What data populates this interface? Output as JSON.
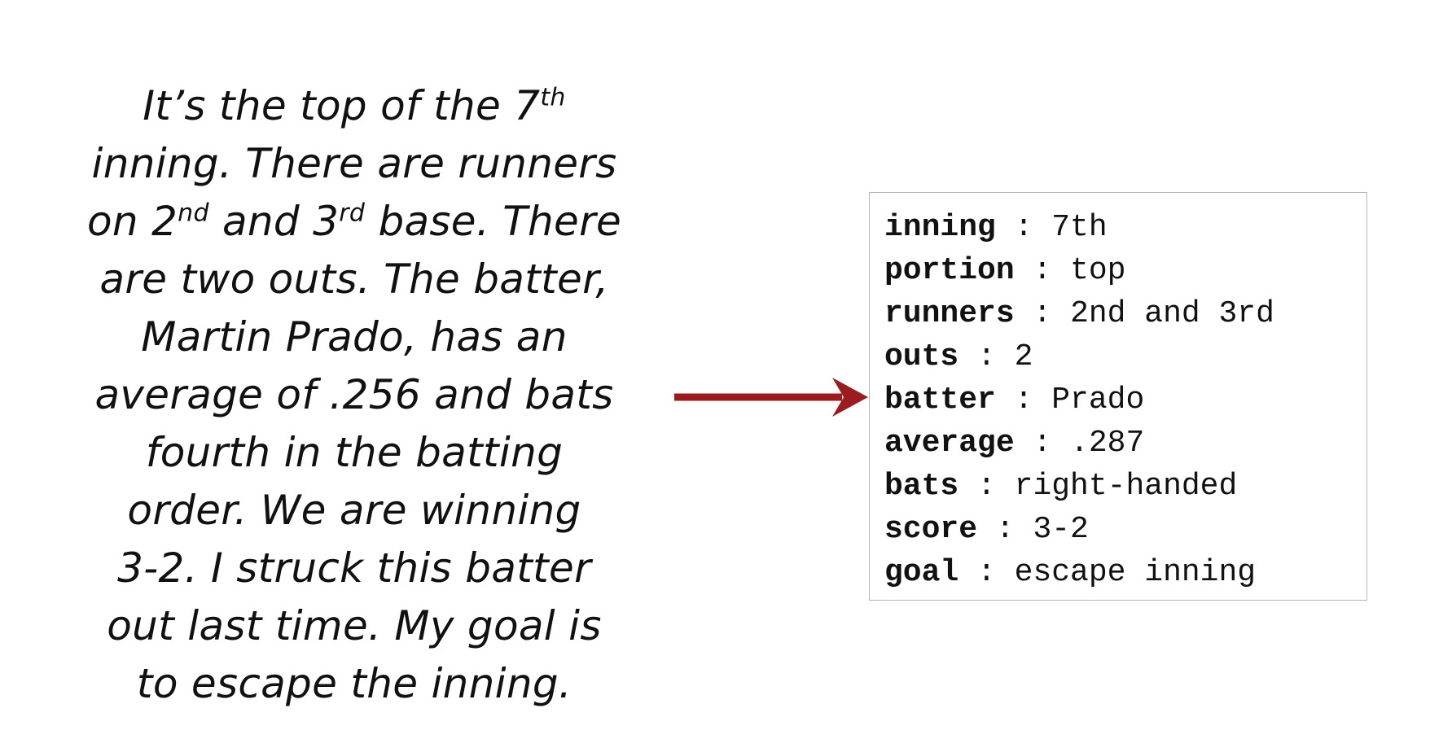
{
  "narrative": {
    "lines": [
      {
        "parts": [
          {
            "text": "It’s the top of the 7"
          },
          {
            "sup": "th"
          }
        ]
      },
      {
        "parts": [
          {
            "text": "inning. There are runners"
          }
        ]
      },
      {
        "parts": [
          {
            "text": "on 2"
          },
          {
            "sup": "nd"
          },
          {
            "text": " and 3"
          },
          {
            "sup": "rd"
          },
          {
            "text": " base. There"
          }
        ]
      },
      {
        "parts": [
          {
            "text": "are two outs. The batter,"
          }
        ]
      },
      {
        "parts": [
          {
            "text": "Martin Prado, has an"
          }
        ]
      },
      {
        "parts": [
          {
            "text": "average of .256 and bats"
          }
        ]
      },
      {
        "parts": [
          {
            "text": "fourth in the batting"
          }
        ]
      },
      {
        "parts": [
          {
            "text": "order. We are winning"
          }
        ]
      },
      {
        "parts": [
          {
            "text": "3-2. I struck this batter"
          }
        ]
      },
      {
        "parts": [
          {
            "text": "out last time. My goal is"
          }
        ]
      },
      {
        "parts": [
          {
            "text": "to escape the inning."
          }
        ]
      }
    ]
  },
  "structure": {
    "separator": " : ",
    "fields": [
      {
        "key": "inning",
        "value": "7th"
      },
      {
        "key": "portion",
        "value": "top"
      },
      {
        "key": "runners",
        "value": "2nd and 3rd"
      },
      {
        "key": "outs",
        "value": "2"
      },
      {
        "key": "batter",
        "value": "Prado"
      },
      {
        "key": "average",
        "value": ".287"
      },
      {
        "key": "bats",
        "value": "right-handed"
      },
      {
        "key": "score",
        "value": "3-2"
      },
      {
        "key": "goal",
        "value": "escape inning"
      }
    ]
  },
  "colors": {
    "arrow": "#9b1b1f",
    "box_border": "#b5b5b5",
    "text": "#111111"
  }
}
